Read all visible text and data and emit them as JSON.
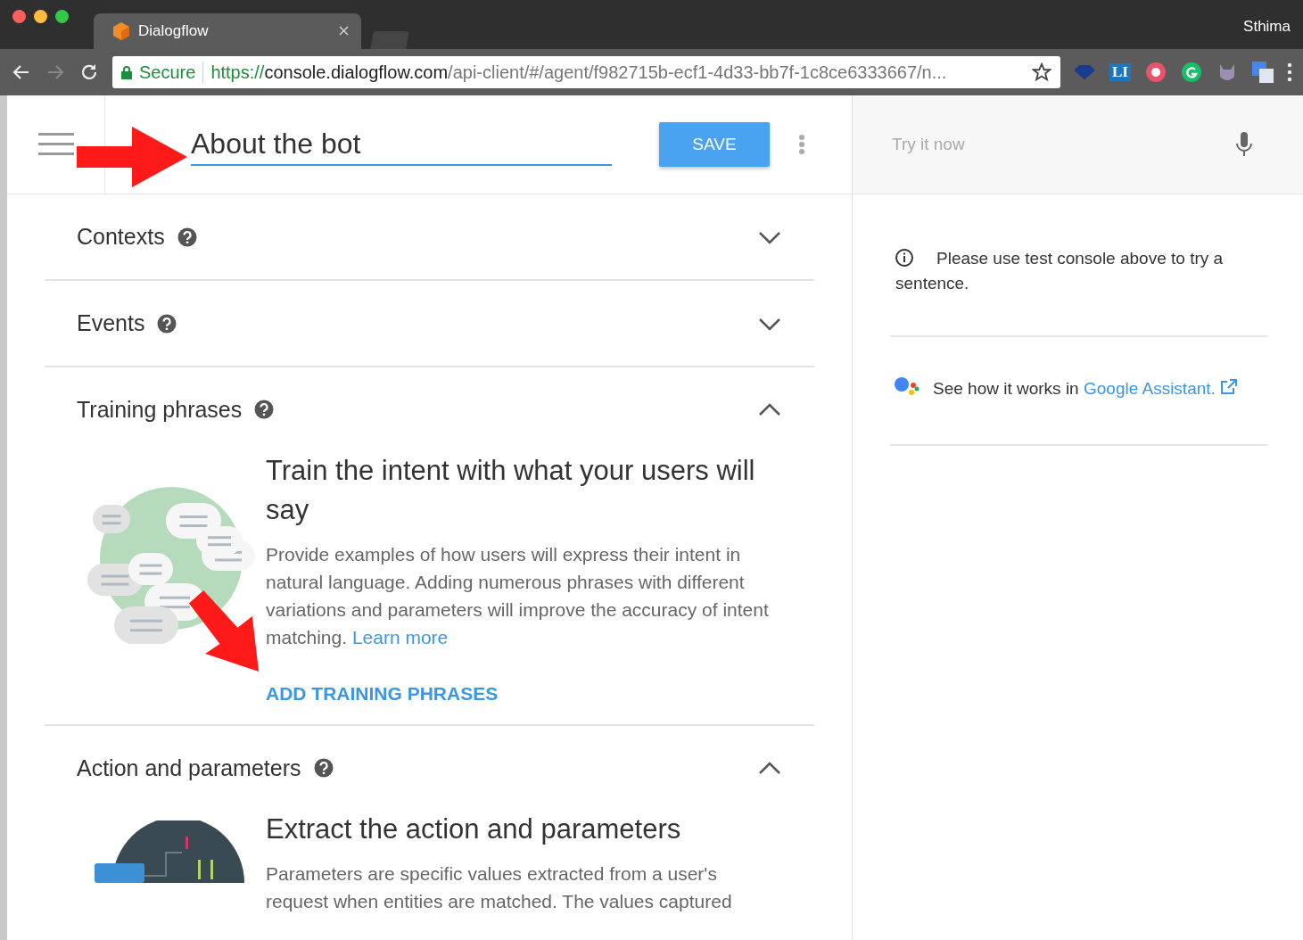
{
  "browser": {
    "tab": {
      "title": "Dialogflow"
    },
    "profile": "Sthima",
    "address": {
      "security": "Secure",
      "scheme": "https://",
      "host": "console.dialogflow.com",
      "path": "/api-client/#/agent/f982715b-ecf1-4d33-bb7f-1c8ce6333667/n..."
    },
    "extension_label": "LI"
  },
  "intent": {
    "name": "About the bot",
    "save": "SAVE"
  },
  "sections": [
    {
      "title": "Contexts",
      "expanded": false
    },
    {
      "title": "Events",
      "expanded": false
    },
    {
      "kind": "training",
      "title": "Training phrases",
      "expanded": true,
      "heading": "Train the intent with what your users will say",
      "description": "Provide examples of how users will express their intent in natural language. Adding numerous phrases with different variations and parameters will improve the accuracy of intent matching.",
      "link": "Learn more",
      "action": "ADD TRAINING PHRASES"
    },
    {
      "kind": "action",
      "title": "Action and parameters",
      "expanded": true,
      "heading": "Extract the action and parameters",
      "description": "Parameters are specific values extracted from a user's request when entities are matched. The values captured"
    }
  ],
  "test_panel": {
    "placeholder": "Try it now",
    "info": "Please use test console above to try a sentence.",
    "assistant_text": "See how it works in",
    "assistant_link": "Google Assistant."
  }
}
